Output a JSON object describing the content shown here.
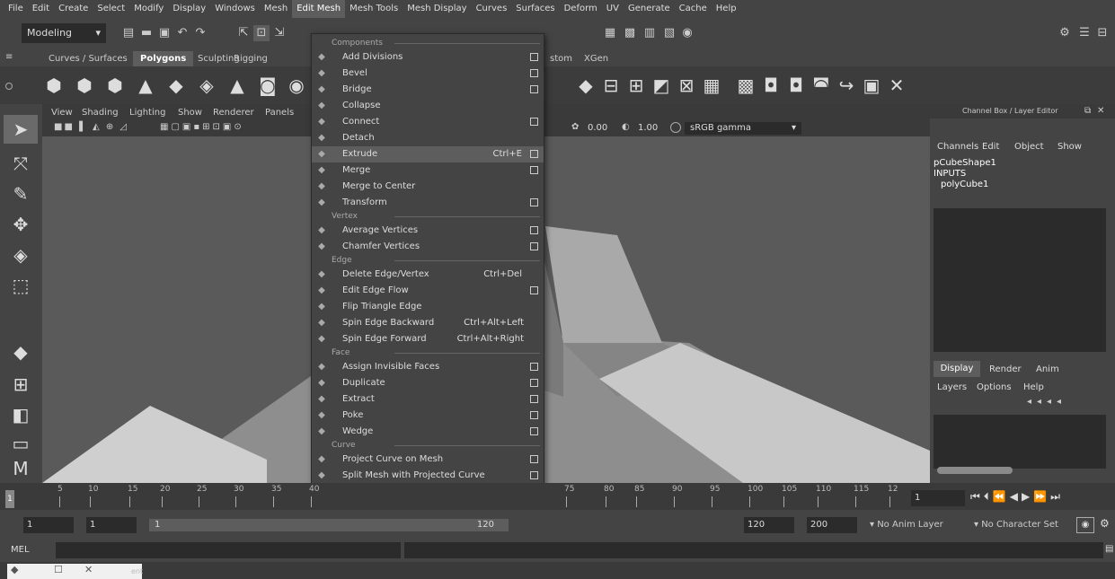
{
  "menubar": [
    "File",
    "Edit",
    "Create",
    "Select",
    "Modify",
    "Display",
    "Windows",
    "Mesh",
    "Edit Mesh",
    "Mesh Tools",
    "Mesh Display",
    "Curves",
    "Surfaces",
    "Deform",
    "UV",
    "Generate",
    "Cache",
    "Help"
  ],
  "menubar_active": "Edit Mesh",
  "workspace": "Modeling",
  "shelf_tabs": [
    "Curves / Surfaces",
    "Polygons",
    "Sculpting",
    "Rigging"
  ],
  "shelf_tabs_right": [
    "stom",
    "XGen"
  ],
  "active_shelf": "Polygons",
  "viewport_menu": [
    "View",
    "Shading",
    "Lighting",
    "Show",
    "Renderer",
    "Panels"
  ],
  "viewport_fields": {
    "exposure": "0.00",
    "gamma": "1.00",
    "colorspace": "sRGB gamma"
  },
  "edit_mesh_menu": {
    "sections": {
      "components": "Components",
      "vertex": "Vertex",
      "edge": "Edge",
      "face": "Face",
      "curve": "Curve"
    },
    "components": [
      {
        "label": "Add Divisions",
        "shortcut": "",
        "options": true,
        "icon": "add-divisions-icon"
      },
      {
        "label": "Bevel",
        "shortcut": "",
        "options": true,
        "icon": "bevel-icon"
      },
      {
        "label": "Bridge",
        "shortcut": "",
        "options": true,
        "icon": "bridge-icon"
      },
      {
        "label": "Collapse",
        "shortcut": "",
        "options": false,
        "icon": "collapse-icon"
      },
      {
        "label": "Connect",
        "shortcut": "",
        "options": true,
        "icon": "connect-icon"
      },
      {
        "label": "Detach",
        "shortcut": "",
        "options": false,
        "icon": "detach-icon"
      },
      {
        "label": "Extrude",
        "shortcut": "Ctrl+E",
        "options": true,
        "icon": "extrude-icon"
      },
      {
        "label": "Merge",
        "shortcut": "",
        "options": true,
        "icon": "merge-icon"
      },
      {
        "label": "Merge to Center",
        "shortcut": "",
        "options": false,
        "icon": "merge-center-icon"
      },
      {
        "label": "Transform",
        "shortcut": "",
        "options": true,
        "icon": "transform-icon"
      }
    ],
    "vertex": [
      {
        "label": "Average Vertices",
        "shortcut": "",
        "options": true,
        "icon": "average-vertices-icon"
      },
      {
        "label": "Chamfer Vertices",
        "shortcut": "",
        "options": true,
        "icon": "chamfer-vertices-icon"
      }
    ],
    "edge": [
      {
        "label": "Delete Edge/Vertex",
        "shortcut": "Ctrl+Del",
        "options": false,
        "icon": "delete-edge-icon"
      },
      {
        "label": "Edit Edge Flow",
        "shortcut": "",
        "options": true,
        "icon": "edge-flow-icon"
      },
      {
        "label": "Flip Triangle Edge",
        "shortcut": "",
        "options": false,
        "icon": "flip-edge-icon"
      },
      {
        "label": "Spin Edge Backward",
        "shortcut": "Ctrl+Alt+Left",
        "options": false,
        "icon": "spin-back-icon"
      },
      {
        "label": "Spin Edge Forward",
        "shortcut": "Ctrl+Alt+Right",
        "options": false,
        "icon": "spin-forward-icon"
      }
    ],
    "face": [
      {
        "label": "Assign Invisible Faces",
        "shortcut": "",
        "options": true,
        "icon": "invisible-faces-icon"
      },
      {
        "label": "Duplicate",
        "shortcut": "",
        "options": true,
        "icon": "duplicate-icon"
      },
      {
        "label": "Extract",
        "shortcut": "",
        "options": true,
        "icon": "extract-icon"
      },
      {
        "label": "Poke",
        "shortcut": "",
        "options": true,
        "icon": "poke-icon"
      },
      {
        "label": "Wedge",
        "shortcut": "",
        "options": true,
        "icon": "wedge-icon"
      }
    ],
    "curve": [
      {
        "label": "Project Curve on Mesh",
        "shortcut": "",
        "options": true,
        "icon": "project-curve-icon"
      },
      {
        "label": "Split Mesh with Projected Curve",
        "shortcut": "",
        "options": true,
        "icon": "split-mesh-icon"
      }
    ]
  },
  "channel_box": {
    "title": "Channel Box / Layer Editor",
    "menu": [
      "Channels",
      "Edit",
      "Object",
      "Show"
    ],
    "shape": "pCubeShape1",
    "inputs_label": "INPUTS",
    "input": "polyCube1"
  },
  "layer_editor": {
    "tabs": [
      "Display",
      "Render",
      "Anim"
    ],
    "menu": [
      "Layers",
      "Options",
      "Help"
    ]
  },
  "timeline": {
    "ticks": [
      "5",
      "10",
      "15",
      "20",
      "25",
      "30",
      "35",
      "40",
      "75",
      "80",
      "85",
      "90",
      "95",
      "100",
      "105",
      "110",
      "115",
      "12"
    ],
    "current_frame": "1"
  },
  "range": {
    "start": "1",
    "start2": "1",
    "slider_start": "1",
    "slider_end": "120",
    "end": "120",
    "end2": "200",
    "anim_layer": "No Anim Layer",
    "char_set": "No Character Set"
  },
  "cmd": {
    "lang": "MEL"
  },
  "help": {
    "text": "ent"
  }
}
